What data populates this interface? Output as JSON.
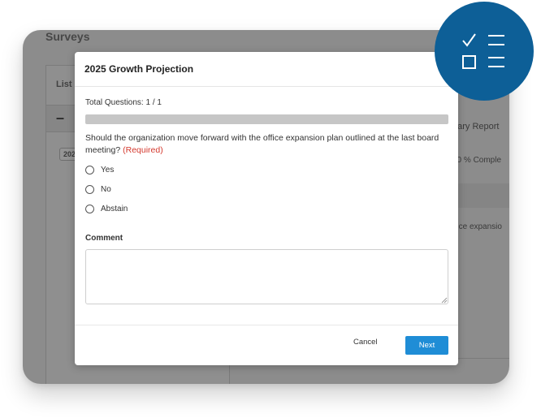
{
  "background": {
    "window_title": "Surveys",
    "list_title": "List o",
    "collapse_symbol": "–",
    "tag_label": "202",
    "summary_report": "nary Report",
    "completion_text": ": 0 % Comple",
    "expansion_text": "ffice expansio"
  },
  "modal": {
    "title": "2025 Growth Projection",
    "question_count": "Total Questions: 1 / 1",
    "progress_fraction": 1.0,
    "question_text": "Should the organization move forward with the office expansion plan outlined at the last board meeting?",
    "required_label": "(Required)",
    "options": [
      {
        "label": "Yes"
      },
      {
        "label": "No"
      },
      {
        "label": "Abstain"
      }
    ],
    "comment_label": "Comment",
    "comment_value": "",
    "cancel_label": "Cancel",
    "next_label": "Next"
  },
  "colors": {
    "accent": "#1f8dd6",
    "required": "#d43a2f",
    "badge": "#0d5f97"
  },
  "icons": {
    "badge": "checklist-icon"
  }
}
